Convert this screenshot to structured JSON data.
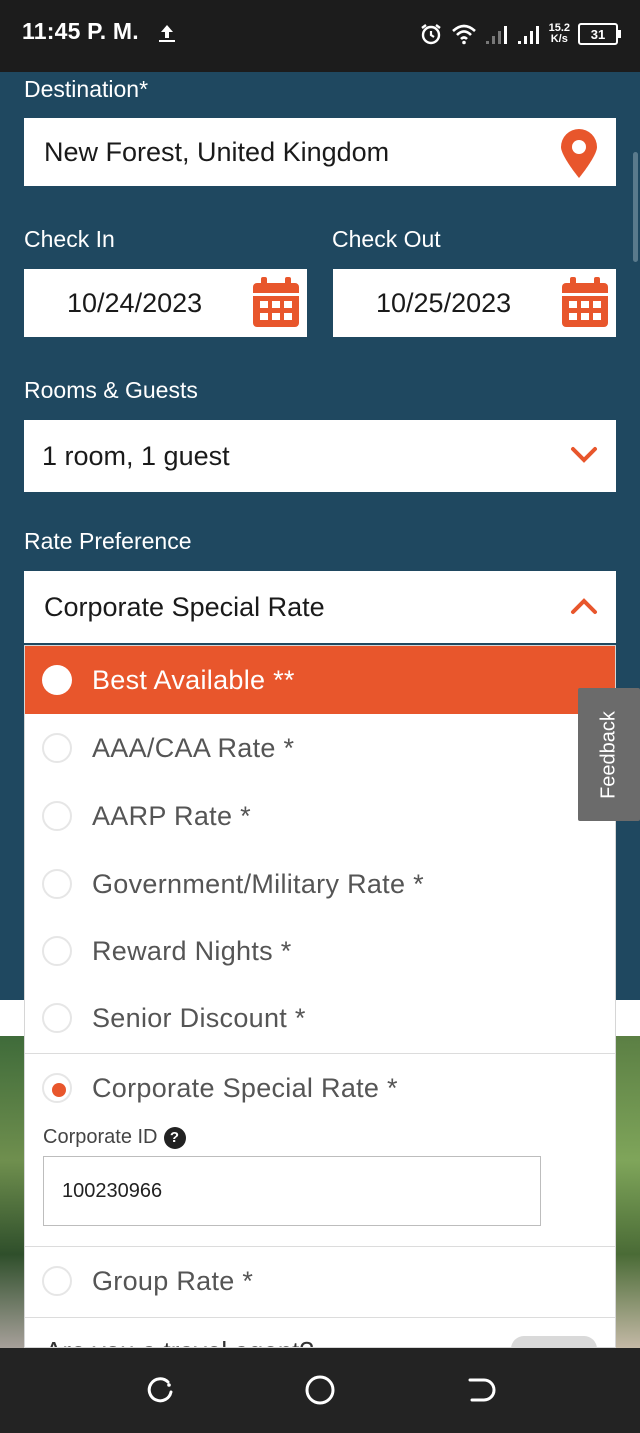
{
  "status_bar": {
    "time": "11:45 P. M.",
    "speed_value": "15.2",
    "speed_unit": "K/s",
    "battery": "31"
  },
  "form": {
    "destination_label": "Destination*",
    "destination_value": "New Forest, United Kingdom",
    "check_in_label": "Check In",
    "check_in_value": "10/24/2023",
    "check_out_label": "Check Out",
    "check_out_value": "10/25/2023",
    "rooms_label": "Rooms & Guests",
    "rooms_value": "1 room, 1 guest",
    "rate_label": "Rate Preference",
    "rate_value": "Corporate Special Rate"
  },
  "rate_options": [
    {
      "label": "Best Available **",
      "state": "highlighted"
    },
    {
      "label": "AAA/CAA Rate *",
      "state": "unselected"
    },
    {
      "label": "AARP Rate *",
      "state": "unselected"
    },
    {
      "label": "Government/Military Rate *",
      "state": "unselected"
    },
    {
      "label": "Reward Nights *",
      "state": "unselected"
    },
    {
      "label": "Senior Discount *",
      "state": "unselected"
    },
    {
      "label": "Corporate Special Rate *",
      "state": "selected"
    },
    {
      "label": "Group Rate *",
      "state": "unselected"
    }
  ],
  "corporate": {
    "id_label": "Corporate ID",
    "id_value": "100230966"
  },
  "travel_agent_label": "Are you a travel agent?",
  "feedback_label": "Feedback",
  "colors": {
    "accent": "#e8562c",
    "form_background": "#1f4860"
  }
}
